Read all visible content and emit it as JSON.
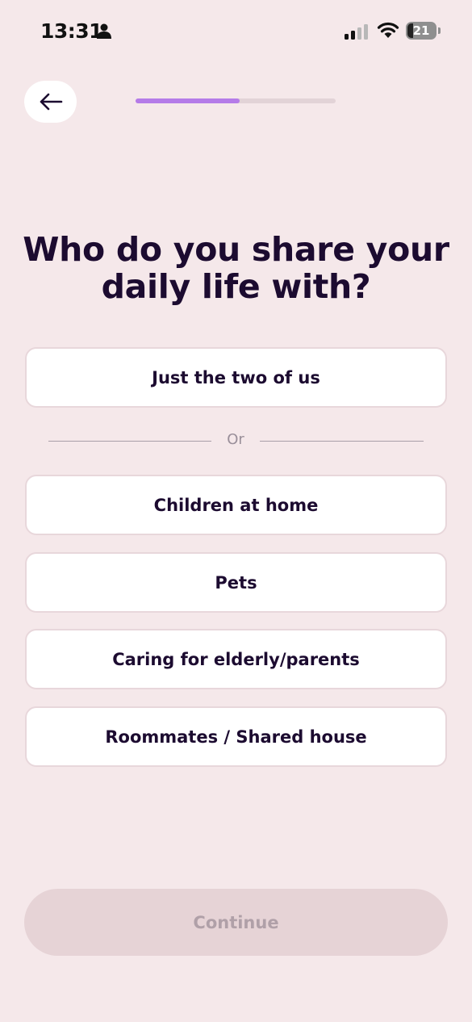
{
  "status_bar": {
    "time": "13:31",
    "battery": "21"
  },
  "progress": {
    "fraction": 0.52
  },
  "question": {
    "title": "Who do you share your daily life with?"
  },
  "options": {
    "primary": "Just the two of us",
    "divider_label": "Or",
    "items": [
      "Children at home",
      "Pets",
      "Caring for elderly/parents",
      "Roommates / Shared house"
    ]
  },
  "footer": {
    "continue_label": "Continue",
    "continue_enabled": false
  },
  "colors": {
    "accent": "#b57be8",
    "background": "#f5e8ea",
    "text": "#1c0b30"
  }
}
